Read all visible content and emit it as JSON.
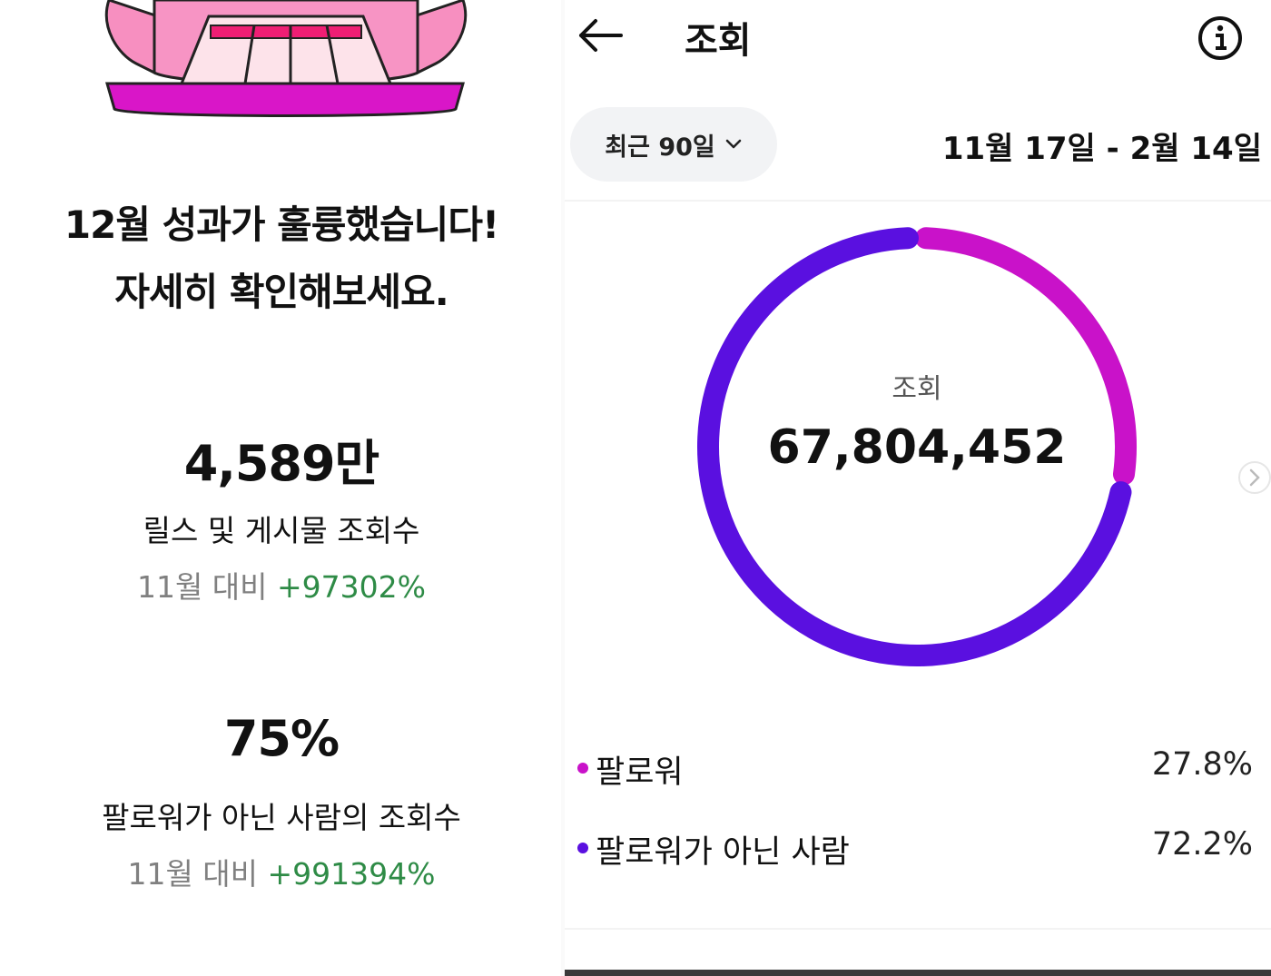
{
  "promo": {
    "headline_line1": "12월 성과가 훌륭했습니다!",
    "headline_line2": "자세히 확인해보세요.",
    "stats": [
      {
        "value": "4,589만",
        "label": "릴스 및 게시물 조회수",
        "compare_base": "11월 대비",
        "compare_delta": "+97302%"
      },
      {
        "value": "75%",
        "label": "팔로워가 아닌 사람의 조회수",
        "compare_base": "11월 대비",
        "compare_delta": "+991394%"
      }
    ]
  },
  "insights": {
    "title": "조회",
    "back_icon": "arrow-left-icon",
    "info_icon": "info-circle-icon",
    "range_filter": {
      "label": "최근 90일",
      "icon": "chevron-down-icon"
    },
    "date_range": "11월 17일 - 2월 14일",
    "total_label": "조회",
    "total_value": "67,804,452",
    "next_icon": "chevron-right-icon",
    "colors": {
      "followers": "#c912c9",
      "non_followers": "#5a10e0",
      "positive": "#2e8b46"
    }
  },
  "chart_data": {
    "type": "pie",
    "title": "조회",
    "total": 67804452,
    "categories": [
      "팔로워",
      "팔로워가 아닌 사람"
    ],
    "values": [
      27.8,
      72.2
    ],
    "value_labels": [
      "27.8%",
      "72.2%"
    ],
    "colors": [
      "#c912c9",
      "#5a10e0"
    ]
  }
}
